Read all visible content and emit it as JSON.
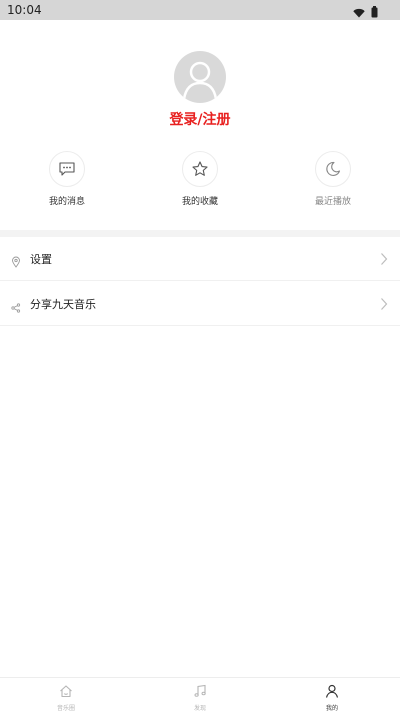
{
  "status_bar": {
    "time": "10:04"
  },
  "profile": {
    "login_label": "登录/注册"
  },
  "quick_actions": [
    {
      "label": "我的消息",
      "icon": "message-icon"
    },
    {
      "label": "我的收藏",
      "icon": "star-icon"
    },
    {
      "label": "最近播放",
      "icon": "moon-icon"
    }
  ],
  "menu": [
    {
      "label": "设置",
      "icon": "settings-icon"
    },
    {
      "label": "分享九天音乐",
      "icon": "share-icon"
    }
  ],
  "tabs": [
    {
      "label": "音乐圈",
      "icon": "home-icon",
      "active": false
    },
    {
      "label": "发现",
      "icon": "music-note-icon",
      "active": false
    },
    {
      "label": "我的",
      "icon": "user-icon",
      "active": true
    }
  ],
  "colors": {
    "accent": "#e8201f",
    "status_bar": "#d6d6d6",
    "divider": "#f3f3f3"
  }
}
